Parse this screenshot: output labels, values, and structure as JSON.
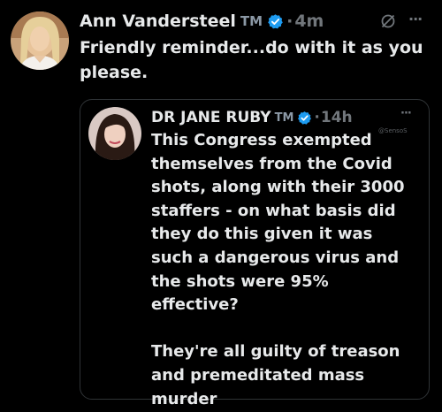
{
  "colors": {
    "background": "#000000",
    "text": "#e7e9ea",
    "muted": "#71767b",
    "verified_badge": "#1d9bf0",
    "card_border": "#2f3336"
  },
  "tweet": {
    "author": {
      "display_name": "Ann Vandersteel",
      "tm_mark": "TM",
      "verified_icon": "verified-badge-icon",
      "avatar_icon": "avatar"
    },
    "separator": "·",
    "time": "4m",
    "grok_icon": "grok-slash-icon",
    "more_icon": "···",
    "text": "Friendly reminder...do with it as you please.",
    "quote": {
      "author": {
        "display_name": "DR JANE RUBY",
        "tm_mark": "TM",
        "verified_icon": "verified-badge-icon",
        "avatar_icon": "avatar"
      },
      "separator": "·",
      "time": "14h",
      "more_icon": "···",
      "watermark": "@SensoS",
      "text": "This Congress exempted themselves from the Covid shots, along with their 3000 staffers - on what basis did they do this given it was such a dangerous virus and the shots were 95% effective?\n\nThey're all guilty of treason and premeditated mass murder"
    }
  }
}
